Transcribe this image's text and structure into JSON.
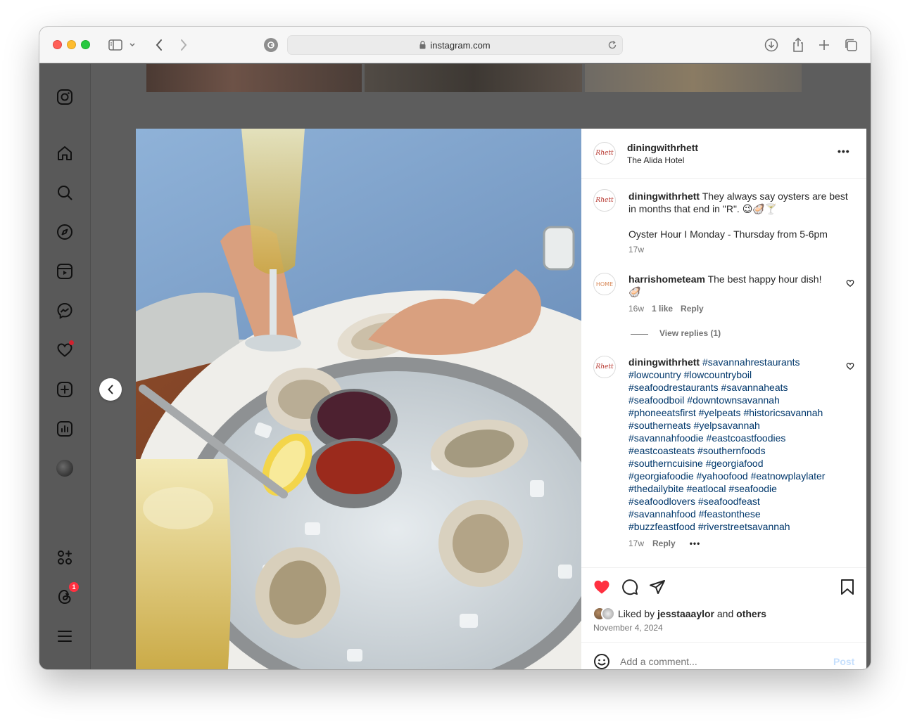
{
  "browser": {
    "url": "instagram.com",
    "url_display": "instagram.com"
  },
  "post": {
    "author": "diningwithrhett",
    "location": "The Alida Hotel",
    "avatar_text": "Rhett",
    "caption": {
      "username": "diningwithrhett",
      "text": "They always say oysters are best in months that end in \"R\". 😉🦪🍸",
      "extra": "Oyster Hour I Monday - Thursday from 5-6pm",
      "time": "17w"
    },
    "comments": [
      {
        "username": "harrishometeam",
        "avatar_text": "HOME",
        "text": "The best happy hour dish! 🦪",
        "time": "16w",
        "likes": "1 like",
        "reply": "Reply",
        "view_replies": "View replies (1)"
      },
      {
        "username": "diningwithrhett",
        "avatar_text": "Rhett",
        "hashtags": "#savannahrestaurants #lowcountry #lowcountryboil #seafoodrestaurants #savannaheats #seafoodboil #downtownsavannah #phoneeatsfirst #yelpeats #historicsavannah #southerneats #yelpsavannah #savannahfoodie #eastcoastfoodies #eastcoasteats #southernfoods #southerncuisine #georgiafood #georgiafoodie #yahoofood #eatnowplaylater #thedailybite #eatlocal #seafoodie #seafoodlovers #seafoodfeast #savannahfood #feastonthese #buzzfeastfood #riverstreetsavannah",
        "hashtag_lines": [
          "#savannahrestaurants",
          "#lowcountry #lowcountryboil",
          "#seafoodrestaurants #savannaheats",
          "#seafoodboil #downtownsavannah",
          "#phoneeatsfirst #yelpeats #historicsavannah",
          "#southerneats #yelpsavannah",
          "#savannahfoodie #eastcoastfoodies",
          "#eastcoasteats #southernfoods",
          "#southerncuisine #georgiafood",
          "#georgiafoodie #yahoofood #eatnowplaylater",
          "#thedailybite #eatlocal #seafoodie",
          "#seafoodlovers #seafoodfeast",
          "#savannahfood #feastonthese",
          "#buzzfeastfood #riverstreetsavannah"
        ],
        "time": "17w",
        "reply": "Reply",
        "more": "•••"
      }
    ],
    "liked_by_prefix": "Liked by",
    "liked_by_user": "jesstaaaylor",
    "liked_by_and": "and",
    "liked_by_others": "others",
    "date": "November 4, 2024",
    "add_comment_placeholder": "Add a comment...",
    "post_button": "Post",
    "more_menu": "•••"
  },
  "sidebar": {
    "notifications_badge": "1",
    "threads_badge": "1"
  },
  "colors": {
    "heart_red": "#ff3040",
    "hashtag_blue": "#00376b",
    "post_button_disabled": "#c7e0fd"
  }
}
